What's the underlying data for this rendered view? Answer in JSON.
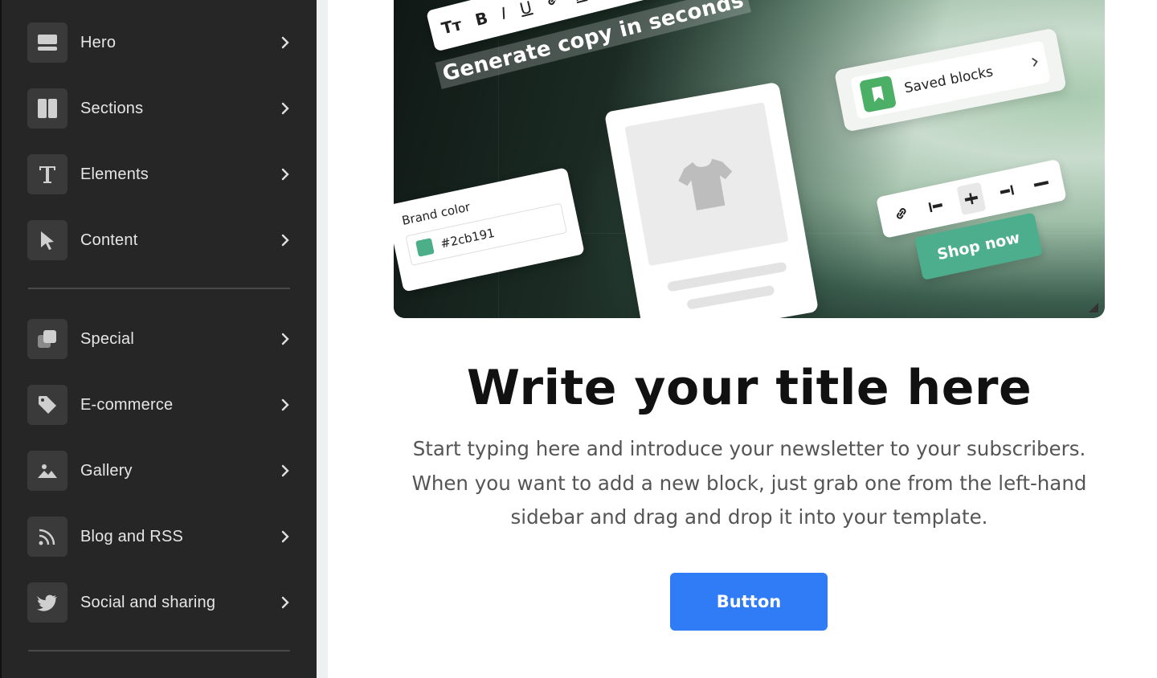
{
  "sidebar": {
    "items": [
      {
        "label": "Hero",
        "icon": "hero-icon"
      },
      {
        "label": "Sections",
        "icon": "columns-icon"
      },
      {
        "label": "Elements",
        "icon": "text-icon"
      },
      {
        "label": "Content",
        "icon": "pointer-icon"
      },
      {
        "label": "Special",
        "icon": "layers-icon"
      },
      {
        "label": "E-commerce",
        "icon": "tag-icon"
      },
      {
        "label": "Gallery",
        "icon": "image-icon"
      },
      {
        "label": "Blog and RSS",
        "icon": "rss-icon"
      },
      {
        "label": "Social and sharing",
        "icon": "twitter-icon"
      }
    ]
  },
  "hero_image": {
    "generate_copy": "Generate copy in seconds",
    "saved_blocks": "Saved blocks",
    "brand_color_label": "Brand color",
    "brand_color_value": "#2cb191",
    "shop_now": "Shop now",
    "toolbar_glyphs": [
      "Tт",
      "B",
      "I",
      "U",
      "A",
      "#"
    ]
  },
  "main": {
    "title": "Write your title here",
    "body": "Start typing here and introduce your newsletter to your subscribers. When you want to add a new block, just grab one from the left-hand sidebar and drag and drop it into your template.",
    "button_label": "Button"
  },
  "colors": {
    "sidebar_bg": "#262626",
    "accent_button": "#2f7cf6",
    "shop_green": "#4cae8c"
  }
}
